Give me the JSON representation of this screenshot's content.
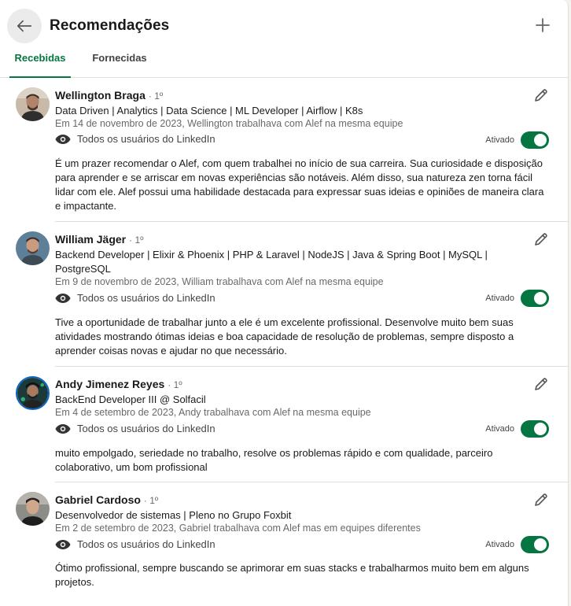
{
  "header": {
    "title": "Recomendações",
    "back_icon": "arrow-left-icon",
    "add_icon": "plus-icon"
  },
  "tabs": [
    {
      "label": "Recebidas",
      "active": true
    },
    {
      "label": "Fornecidas",
      "active": false
    }
  ],
  "colors": {
    "accent": "#057642",
    "divider": "#e0dfdc"
  },
  "recommendations": [
    {
      "name": "Wellington Braga",
      "degree": "· 1º",
      "headline": "Data Driven | Analytics | Data Science | ML Developer | Airflow | K8s",
      "meta": "Em 14 de novembro de 2023, Wellington trabalhava com Alef na mesma equipe",
      "visibility": "Todos os usuários do LinkedIn",
      "toggle_label": "Ativado",
      "text": "É um prazer recomendar o Alef, com quem trabalhei no início de sua carreira. Sua curiosidade e disposição para aprender e se arriscar em novas experiências são notáveis. Além disso, sua natureza zen torna fácil lidar com ele. Alef possui uma habilidade destacada para expressar suas ideias e opiniões de maneira clara e impactante."
    },
    {
      "name": "William Jäger",
      "degree": "· 1º",
      "headline": "Backend Developer | Elixir & Phoenix | PHP & Laravel | NodeJS | Java & Spring Boot | MySQL | PostgreSQL",
      "meta": "Em 9 de novembro de 2023, William trabalhava com Alef na mesma equipe",
      "visibility": "Todos os usuários do LinkedIn",
      "toggle_label": "Ativado",
      "text": "Tive a oportunidade de trabalhar junto a ele é um excelente profissional. Desenvolve muito bem suas atividades mostrando ótimas ideias e boa capacidade de resolução de problemas, sempre disposto a aprender coisas novas e ajudar no que necessário."
    },
    {
      "name": "Andy Jimenez Reyes",
      "degree": "· 1º",
      "headline": "BackEnd Developer III @ Solfacil",
      "meta": "Em 4 de setembro de 2023, Andy trabalhava com Alef na mesma equipe",
      "visibility": "Todos os usuários do LinkedIn",
      "toggle_label": "Ativado",
      "text": "muito empolgado, seriedade no trabalho, resolve os problemas rápido e com qualidade, parceiro colaborativo, um bom profissional"
    },
    {
      "name": "Gabriel Cardoso",
      "degree": "· 1º",
      "headline": "Desenvolvedor de sistemas | Pleno no Grupo Foxbit",
      "meta": "Em 2 de setembro de 2023, Gabriel trabalhava com Alef mas em equipes diferentes",
      "visibility": "Todos os usuários do LinkedIn",
      "toggle_label": "Ativado",
      "text": "Ótimo profissional, sempre buscando se aprimorar em suas stacks e trabalharmos muito bem em alguns projetos."
    }
  ]
}
